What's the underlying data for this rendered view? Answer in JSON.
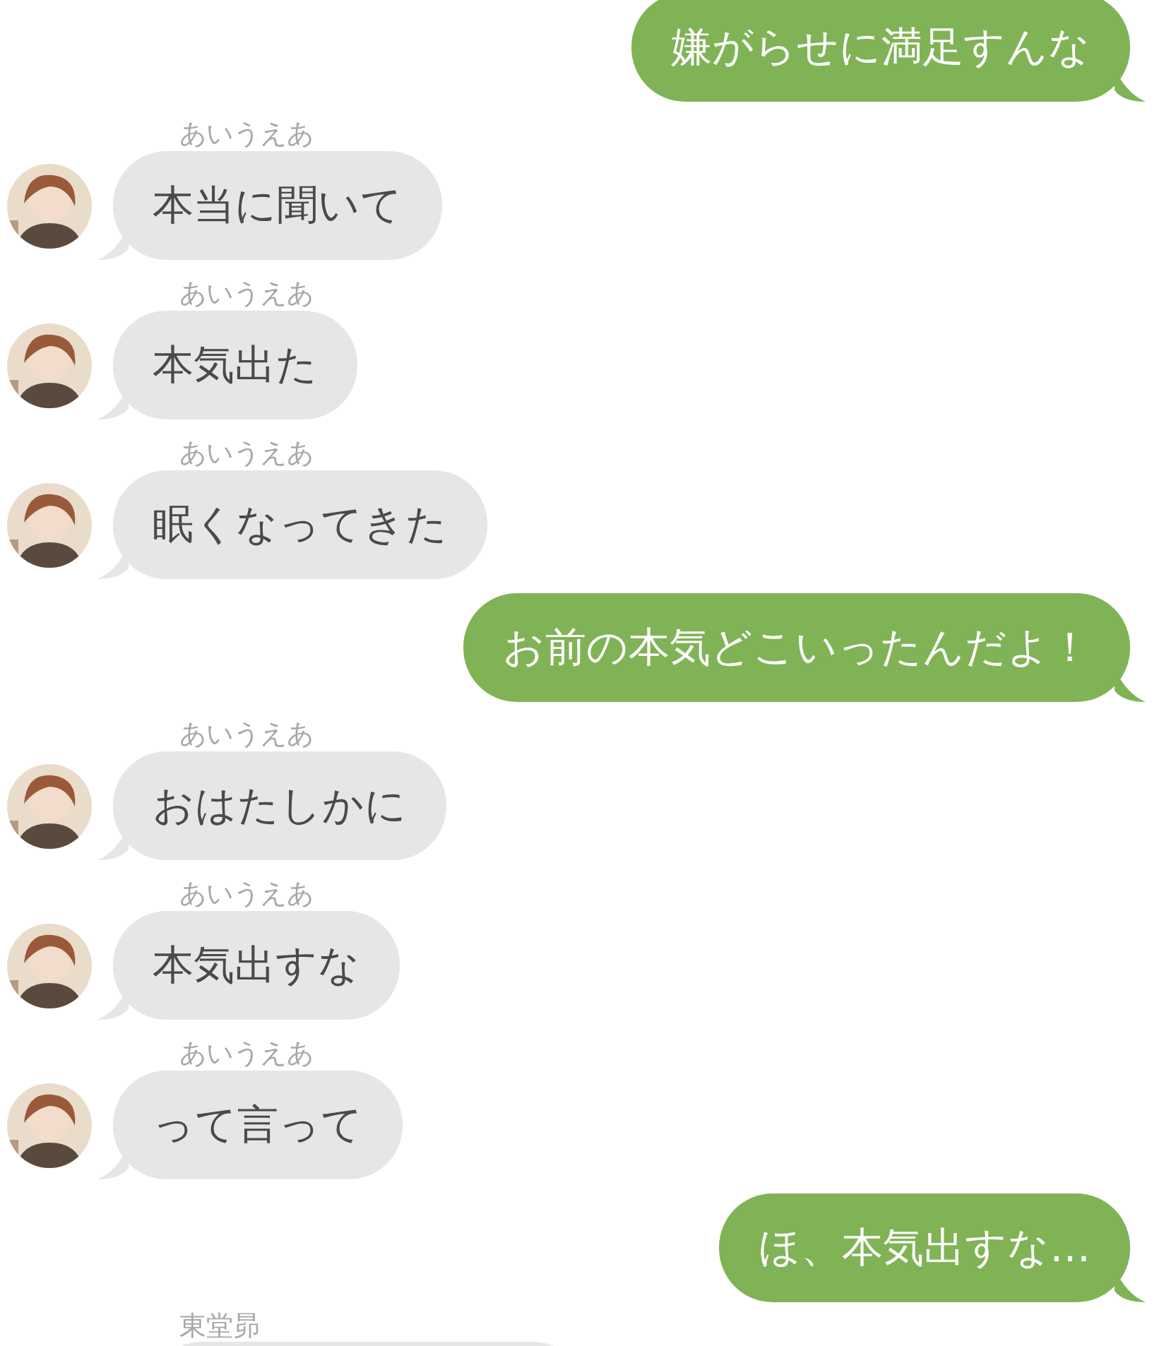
{
  "messages": [
    {
      "kind": "sent",
      "text": "嫌がらせに満足すんな"
    },
    {
      "kind": "received",
      "sender": "あいうえあ",
      "text": "本当に聞いて"
    },
    {
      "kind": "received",
      "sender": "あいうえあ",
      "text": "本気出た"
    },
    {
      "kind": "received",
      "sender": "あいうえあ",
      "text": "眠くなってきた"
    },
    {
      "kind": "sent",
      "text": "お前の本気どこいったんだよ！"
    },
    {
      "kind": "received",
      "sender": "あいうえあ",
      "text": "おはたしかに"
    },
    {
      "kind": "received",
      "sender": "あいうえあ",
      "text": "本気出すな"
    },
    {
      "kind": "received",
      "sender": "あいうえあ",
      "text": "って言って"
    },
    {
      "kind": "sent",
      "text": "ほ、本気出すな…"
    },
    {
      "kind": "received",
      "sender": "東堂昴"
    }
  ]
}
